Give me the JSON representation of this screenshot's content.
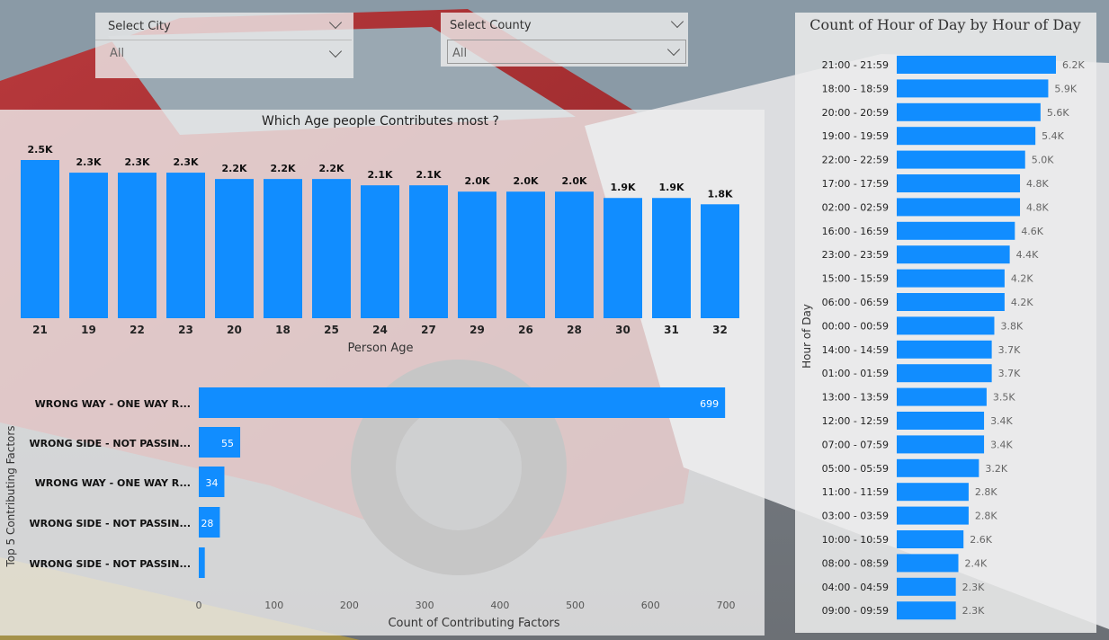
{
  "colors": {
    "bar": "#118DFF",
    "panel": "#e8e8e8",
    "text_dark": "#222222"
  },
  "background": {
    "description_icon": "car-crash-photo"
  },
  "slicers": {
    "city": {
      "title": "Select City",
      "value": "All"
    },
    "county": {
      "title": "Select County",
      "value": "All"
    }
  },
  "age_chart": {
    "chart_data": {
      "type": "bar",
      "title": "Which Age people Contributes most ?",
      "xlabel": "Person Age",
      "ylabel": "",
      "categories": [
        "21",
        "19",
        "22",
        "23",
        "20",
        "18",
        "25",
        "24",
        "27",
        "29",
        "26",
        "28",
        "30",
        "31",
        "32"
      ],
      "values": [
        2.5,
        2.3,
        2.3,
        2.3,
        2.2,
        2.2,
        2.2,
        2.1,
        2.1,
        2.0,
        2.0,
        2.0,
        1.9,
        1.9,
        1.8
      ],
      "labels": [
        "2.5K",
        "2.3K",
        "2.3K",
        "2.3K",
        "2.2K",
        "2.2K",
        "2.2K",
        "2.1K",
        "2.1K",
        "2.0K",
        "2.0K",
        "2.0K",
        "1.9K",
        "1.9K",
        "1.8K"
      ],
      "ylim": [
        0,
        2.5
      ]
    }
  },
  "factors_chart": {
    "chart_data": {
      "type": "bar",
      "orientation": "horizontal",
      "title": "",
      "xlabel": "Count of Contributing Factors",
      "ylabel": "Top 5 Contributing Factors",
      "categories": [
        "WRONG WAY - ONE WAY R...",
        "WRONG SIDE - NOT PASSIN...",
        "WRONG WAY - ONE WAY R...",
        "WRONG SIDE - NOT PASSIN...",
        "WRONG SIDE - NOT PASSIN..."
      ],
      "values": [
        699,
        55,
        34,
        28,
        8
      ],
      "labels": [
        "699",
        "55",
        "34",
        "28",
        ""
      ],
      "xlim": [
        0,
        700
      ],
      "xticks": [
        "0",
        "100",
        "200",
        "300",
        "400",
        "500",
        "600",
        "700"
      ]
    }
  },
  "hour_chart": {
    "chart_data": {
      "type": "bar",
      "orientation": "horizontal",
      "title": "Count of Hour of Day by Hour of Day",
      "xlabel": "",
      "ylabel": "Hour of Day",
      "categories": [
        "21:00 - 21:59",
        "18:00 - 18:59",
        "20:00 - 20:59",
        "19:00 - 19:59",
        "22:00 - 22:59",
        "17:00 - 17:59",
        "02:00 - 02:59",
        "16:00 - 16:59",
        "23:00 - 23:59",
        "15:00 - 15:59",
        "06:00 - 06:59",
        "00:00 - 00:59",
        "14:00 - 14:59",
        "01:00 - 01:59",
        "13:00 - 13:59",
        "12:00 - 12:59",
        "07:00 - 07:59",
        "05:00 - 05:59",
        "11:00 - 11:59",
        "03:00 - 03:59",
        "10:00 - 10:59",
        "08:00 - 08:59",
        "04:00 - 04:59",
        "09:00 - 09:59"
      ],
      "values": [
        6.2,
        5.9,
        5.6,
        5.4,
        5.0,
        4.8,
        4.8,
        4.6,
        4.4,
        4.2,
        4.2,
        3.8,
        3.7,
        3.7,
        3.5,
        3.4,
        3.4,
        3.2,
        2.8,
        2.8,
        2.6,
        2.4,
        2.3,
        2.3
      ],
      "labels": [
        "6.2K",
        "5.9K",
        "5.6K",
        "5.4K",
        "5.0K",
        "4.8K",
        "4.8K",
        "4.6K",
        "4.4K",
        "4.2K",
        "4.2K",
        "3.8K",
        "3.7K",
        "3.7K",
        "3.5K",
        "3.4K",
        "3.4K",
        "3.2K",
        "2.8K",
        "2.8K",
        "2.6K",
        "2.4K",
        "2.3K",
        "2.3K"
      ],
      "xlim": [
        0,
        6.2
      ]
    }
  }
}
